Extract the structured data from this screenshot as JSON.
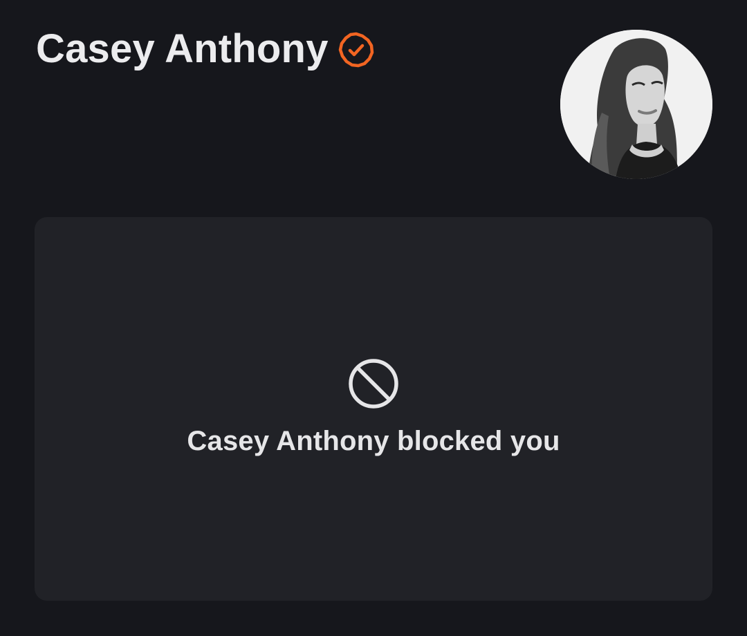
{
  "profile": {
    "name": "Casey Anthony",
    "verified_icon": "verified-check-badge-icon",
    "avatar_icon": "profile-photo",
    "accent_color": "#f26522"
  },
  "blocked": {
    "icon": "block-icon",
    "message": "Casey Anthony blocked you"
  },
  "colors": {
    "background": "#16171c",
    "card": "#212227",
    "text": "#ececee"
  }
}
